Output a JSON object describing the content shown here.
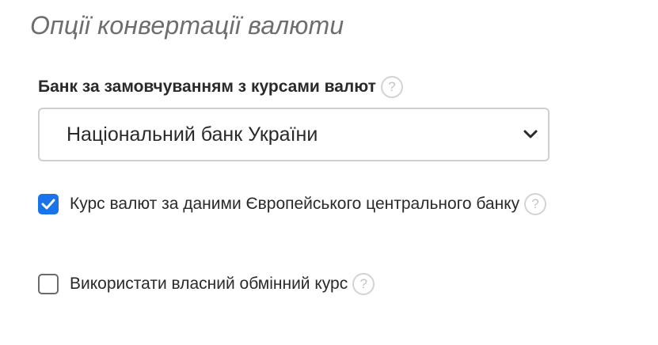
{
  "section": {
    "title": "Опції конвертації валюти"
  },
  "bank_field": {
    "label": "Банк за замовчуванням з курсами валют",
    "help_icon": "question-mark",
    "help_glyph": "?",
    "selected_value": "Національний банк України",
    "dropdown_icon": "chevron-down"
  },
  "options": {
    "ecb": {
      "label": "Курс валют за даними Європейського центрального банку",
      "checked": true,
      "help_glyph": "?"
    },
    "custom": {
      "label": "Використати власний обмінний курс",
      "checked": false,
      "help_glyph": "?"
    }
  },
  "colors": {
    "accent": "#1a73e8",
    "title": "#6e6e6e",
    "border": "#cfcfcf"
  }
}
